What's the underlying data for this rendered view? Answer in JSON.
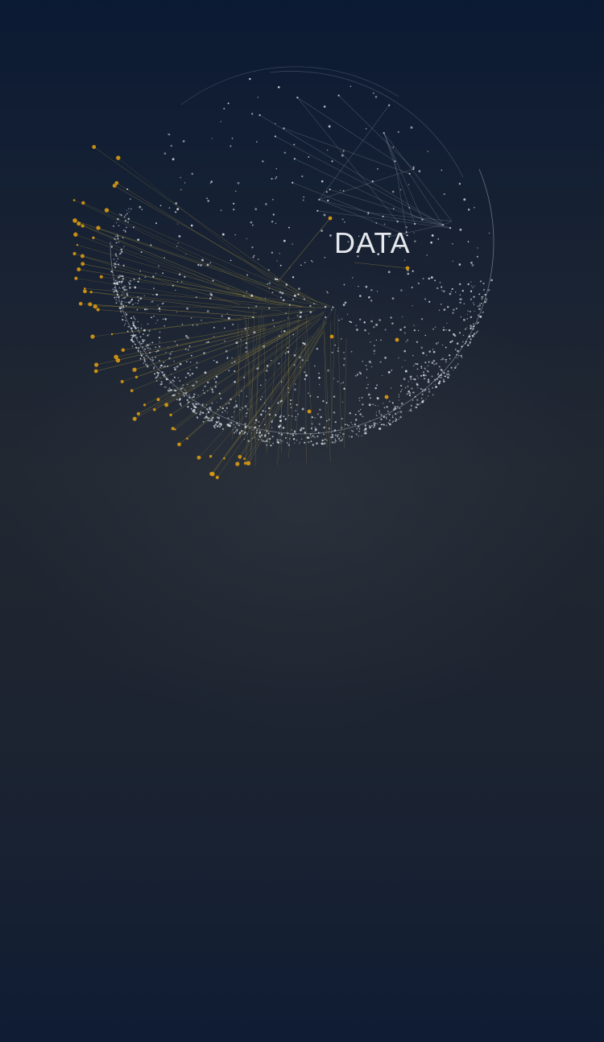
{
  "globe": {
    "label": "DATA",
    "colors": {
      "dots": "#d6dbe3",
      "outline": "#aeb6c2",
      "accent_dots": "#d99a12",
      "accent_lines": "#b9a23a",
      "inner_lines": "#8f9aa8"
    }
  },
  "background": {
    "top": "#0b1a33",
    "middle": "#222832",
    "bottom": "#0f1c33"
  }
}
